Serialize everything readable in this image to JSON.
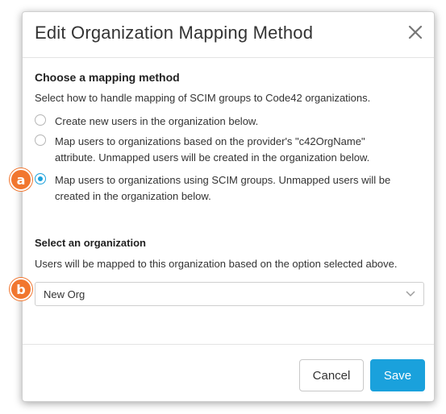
{
  "dialog": {
    "title": "Edit Organization Mapping Method",
    "close_icon": "close-icon"
  },
  "mapping": {
    "title": "Choose a mapping method",
    "description": "Select how to handle mapping of SCIM groups to Code42 organizations.",
    "options": [
      {
        "line1": "Create new users in the organization below.",
        "line2": "",
        "checked": false
      },
      {
        "line1": "Map users to organizations based on the provider's \"c42OrgName\"",
        "line2": "attribute. Unmapped users will be created in the organization below.",
        "checked": false
      },
      {
        "line1": "Map users to organizations using SCIM groups. Unmapped users will be",
        "line2": "created in the organization below.",
        "checked": true
      }
    ]
  },
  "organization": {
    "title": "Select an organization",
    "description": "Users will be mapped to this organization based on the option selected above.",
    "selected": "New Org",
    "chevron_icon": "chevron-down-icon"
  },
  "footer": {
    "cancel_label": "Cancel",
    "save_label": "Save"
  },
  "callouts": {
    "a": "a",
    "b": "b"
  },
  "colors": {
    "accent": "#1aa1dc",
    "callout": "#f1762f"
  }
}
